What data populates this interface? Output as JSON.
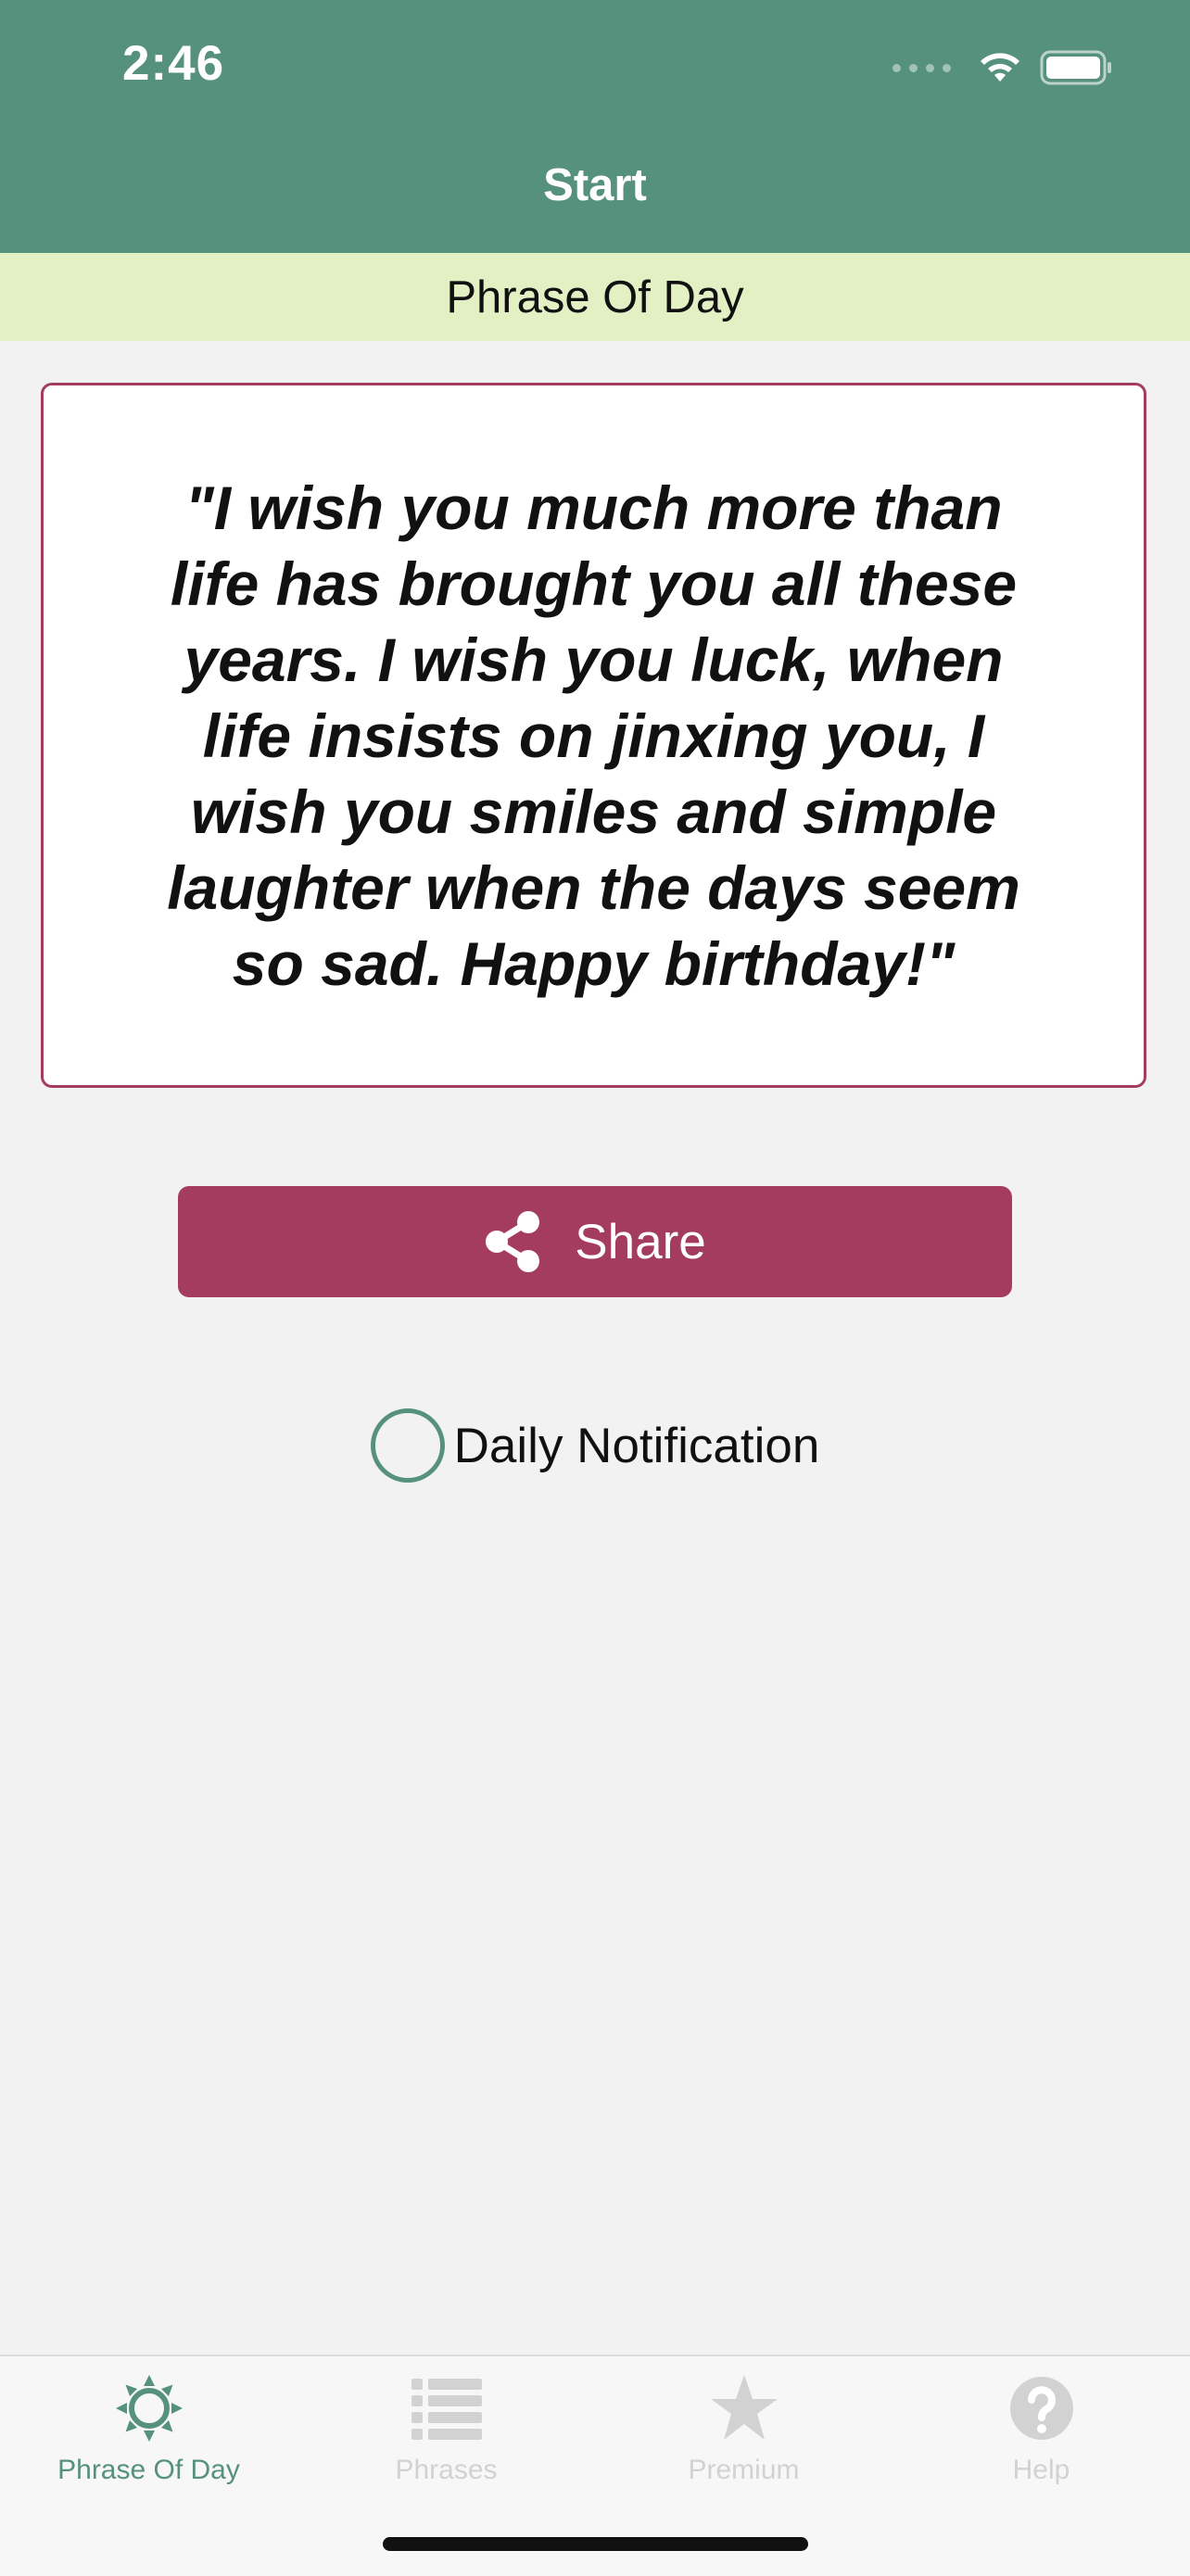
{
  "status_bar": {
    "time": "2:46"
  },
  "nav": {
    "title": "Start"
  },
  "section": {
    "title": "Phrase Of Day"
  },
  "phrase": {
    "text": "\"I wish you much more than life has brought you all these years. I wish you luck, when life insists on jinxing you, I wish you smiles and simple laughter when the days seem so sad. Happy birthday!\""
  },
  "share_button": {
    "label": "Share",
    "icon": "share-icon"
  },
  "daily_notification": {
    "label": "Daily Notification",
    "checked": false
  },
  "tabs": [
    {
      "label": "Phrase Of Day",
      "icon": "sun-icon",
      "active": true
    },
    {
      "label": "Phrases",
      "icon": "list-icon",
      "active": false
    },
    {
      "label": "Premium",
      "icon": "star-icon",
      "active": false
    },
    {
      "label": "Help",
      "icon": "help-icon",
      "active": false
    }
  ],
  "colors": {
    "primary": "#56917d",
    "accent": "#a33c5f",
    "section_background": "#e2f0c4",
    "page_background": "#f2f2f2",
    "inactive_tab": "#d2d2d2"
  }
}
